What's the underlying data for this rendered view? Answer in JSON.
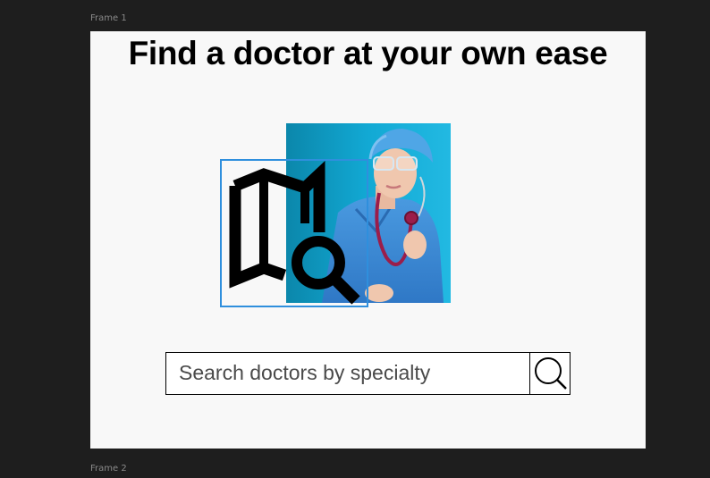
{
  "canvas": {
    "frames": [
      {
        "label": "Frame 1"
      },
      {
        "label": "Frame 2"
      }
    ]
  },
  "hero": {
    "title": "Find a doctor at your own ease"
  },
  "illustration": {
    "map_icon": "map-search-icon",
    "photo": "doctor-with-stethoscope-photo",
    "selection_color": "#2f8fdd"
  },
  "search": {
    "placeholder": "Search doctors by specialty",
    "value": "",
    "button_icon": "search-icon"
  },
  "colors": {
    "canvas_background": "#1e1e1e",
    "frame_background": "#f8f8f8",
    "photo_background": "#0fa6cf",
    "scrubs": "#3f8fd8",
    "stethoscope": "#9b1d4a"
  }
}
